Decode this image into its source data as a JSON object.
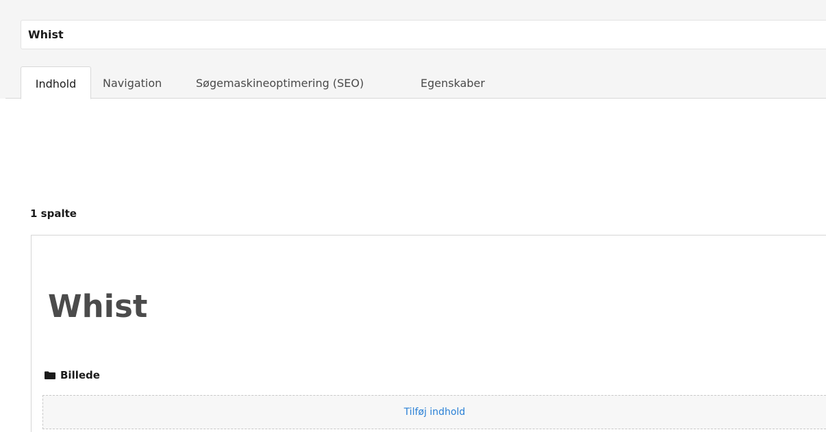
{
  "page": {
    "title_value": "Whist"
  },
  "tabs": [
    {
      "label": "Indhold",
      "active": true
    },
    {
      "label": "Navigation",
      "active": false
    },
    {
      "label": "Søgemaskineoptimering (SEO)",
      "active": false
    },
    {
      "label": "Egenskaber",
      "active": false
    }
  ],
  "grid": {
    "label": "1 spalte",
    "heading": "Whist",
    "area": {
      "icon": "folder-icon",
      "label": "Billede",
      "add_label": "Tilføj indhold"
    }
  },
  "colors": {
    "link": "#2a80d6",
    "background_band": "#f5f5f5"
  }
}
